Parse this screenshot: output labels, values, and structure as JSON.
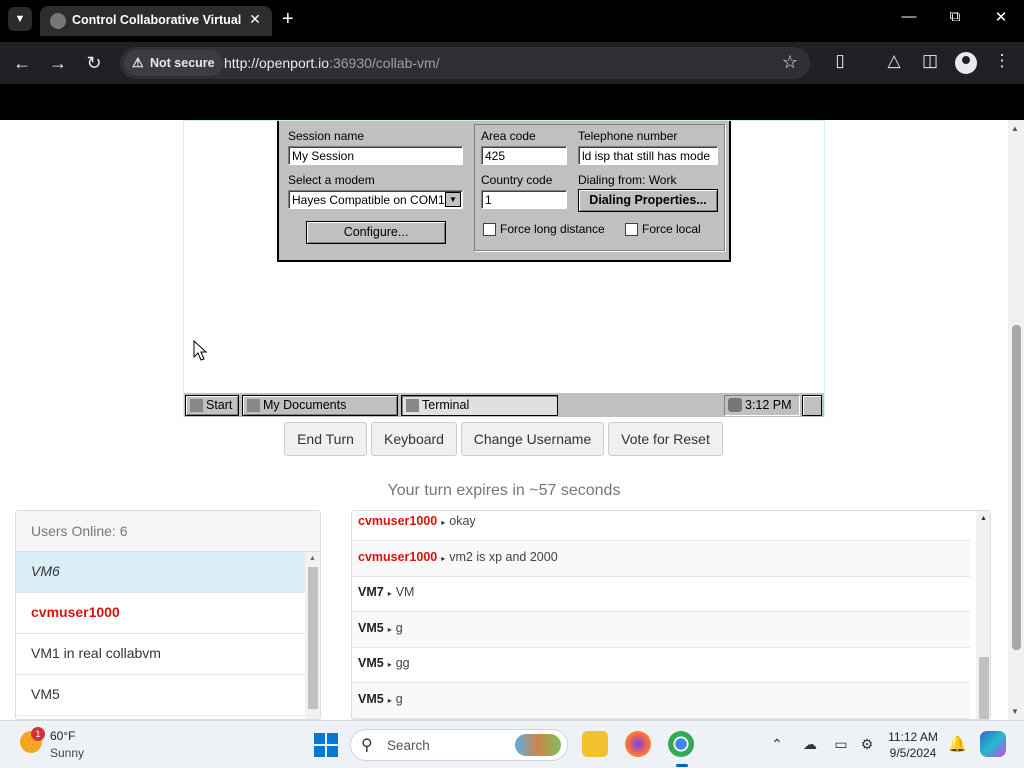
{
  "browser": {
    "tab_title": "Control Collaborative Virtual M",
    "security_label": "Not secure",
    "url_host": "http://openport.io",
    "url_rest": ":36930/collab-vm/"
  },
  "vm": {
    "dialog": {
      "session_name_label": "Session name",
      "session_name_value": "My Session",
      "modem_label": "Select a modem",
      "modem_value": "Hayes Compatible on COM1",
      "configure_button": "Configure...",
      "area_code_label": "Area code",
      "area_code_value": "425",
      "telephone_label": "Telephone number",
      "telephone_value": "ld isp that still has mode",
      "country_code_label": "Country code",
      "country_code_value": "1",
      "dialing_from": "Dialing from: Work",
      "dialing_properties_button": "Dialing Properties...",
      "force_long_distance": "Force long distance",
      "force_local": "Force local"
    },
    "taskbar": {
      "start": "Start",
      "my_documents": "My Documents",
      "terminal": "Terminal",
      "clock": "3:12 PM"
    }
  },
  "actions": {
    "end_turn": "End Turn",
    "keyboard": "Keyboard",
    "change_username": "Change Username",
    "vote_reset": "Vote for Reset"
  },
  "turn_status": "Your turn expires in ~57 seconds",
  "users": {
    "header": "Users Online: 6",
    "list": [
      {
        "name": "VM6"
      },
      {
        "name": "cvmuser1000"
      },
      {
        "name": "VM1 in real collabvm"
      },
      {
        "name": "VM5"
      }
    ]
  },
  "chat": {
    "messages": [
      {
        "user": "cvmuser1000",
        "text": "okay"
      },
      {
        "user": "cvmuser1000",
        "text": "vm2 is xp and 2000"
      },
      {
        "user": "VM7",
        "text": "VM"
      },
      {
        "user": "VM5",
        "text": "g"
      },
      {
        "user": "VM5",
        "text": "gg"
      },
      {
        "user": "VM5",
        "text": "g"
      }
    ]
  },
  "windows_taskbar": {
    "weather_badge": "1",
    "temperature": "60°F",
    "condition": "Sunny",
    "search_placeholder": "Search",
    "time": "11:12 AM",
    "date": "9/5/2024"
  },
  "colors": {
    "accent_red": "#d9140c",
    "selected_row": "#d9edf7",
    "win95_gray": "#c0c0c0"
  }
}
